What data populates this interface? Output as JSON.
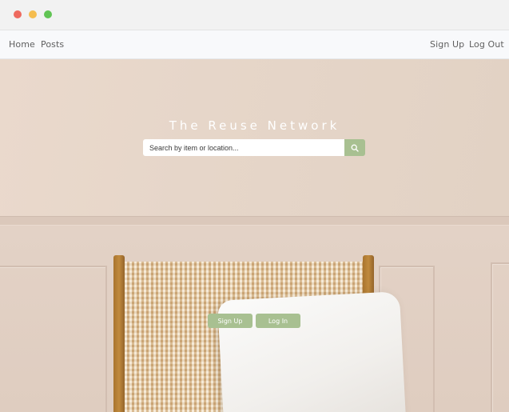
{
  "window": {
    "controls": [
      "close",
      "minimize",
      "maximize"
    ]
  },
  "nav": {
    "left": [
      {
        "label": "Home"
      },
      {
        "label": "Posts"
      }
    ],
    "right": [
      {
        "label": "Sign Up"
      },
      {
        "label": "Log Out"
      }
    ]
  },
  "hero": {
    "title": "The Reuse Network",
    "search": {
      "value": "",
      "placeholder": "Search by item or location...",
      "button_icon": "search-icon"
    },
    "buttons": [
      {
        "label": "Sign Up"
      },
      {
        "label": "Log In"
      }
    ]
  },
  "colors": {
    "accent": "#a8c091",
    "nav_bg": "#f8f9fb",
    "nav_text": "#606060",
    "title_text": "#ffffff"
  }
}
